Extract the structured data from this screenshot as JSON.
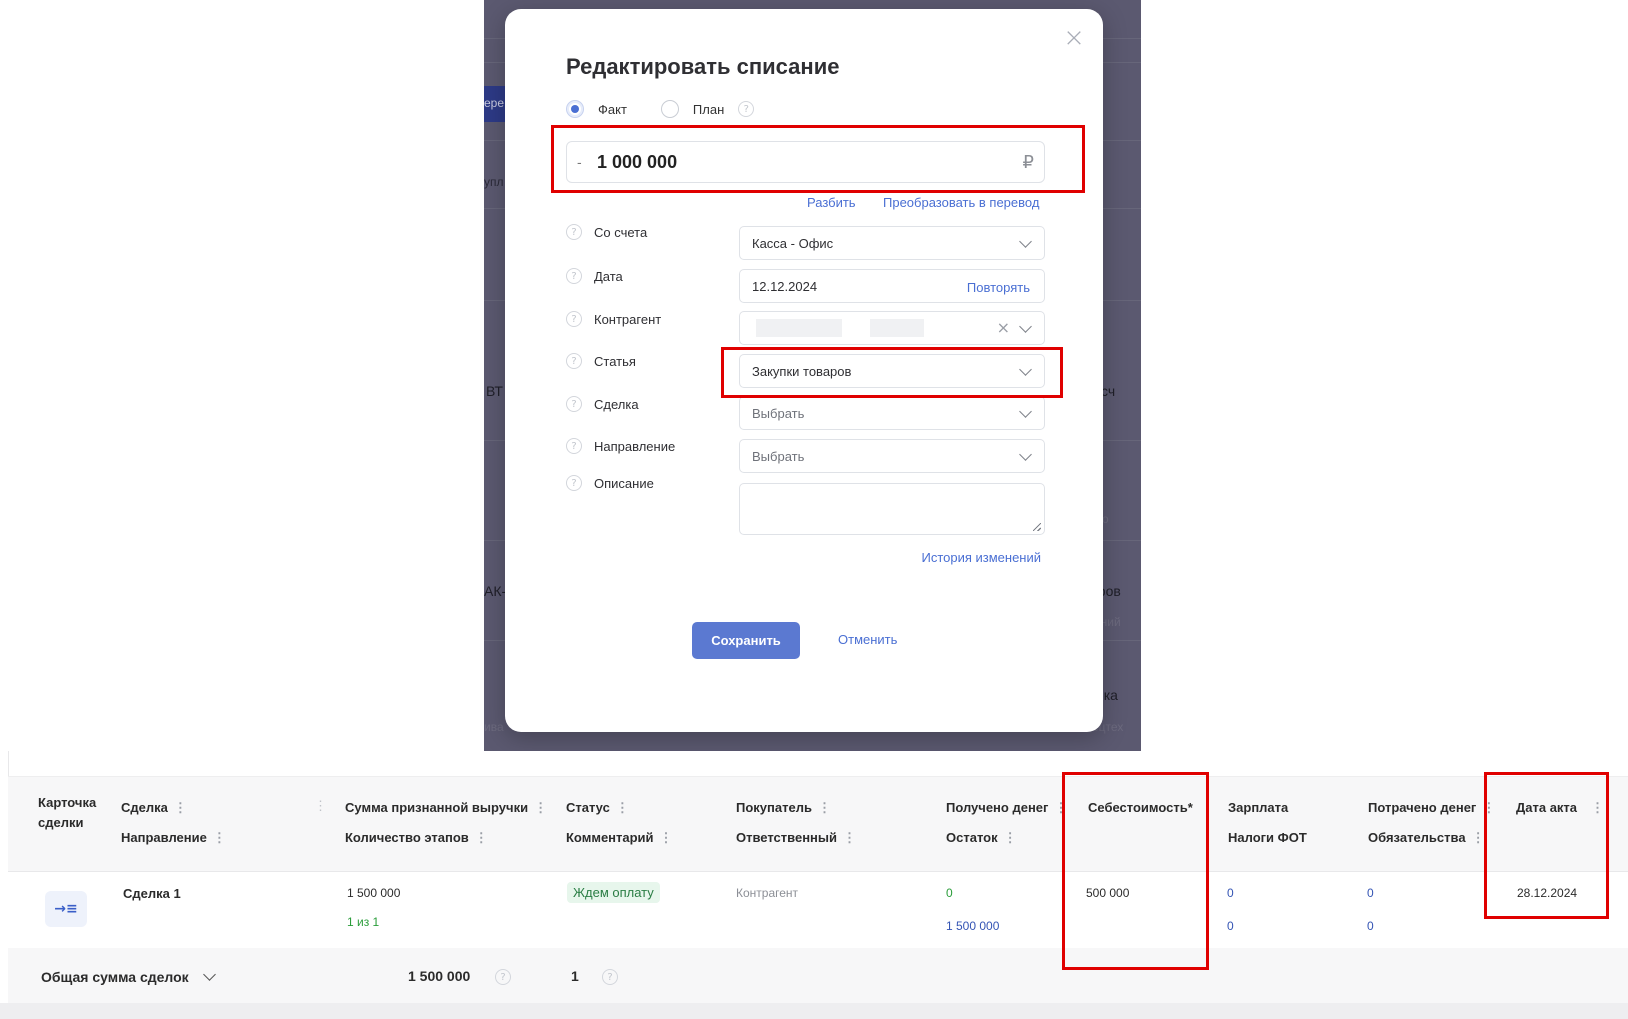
{
  "background": {
    "fragments": [
      "ере",
      "упл",
      "ВТ",
      "ду сч",
      "о",
      "АК-",
      "аров",
      "ений",
      "ива",
      "нка",
      "ецтех"
    ]
  },
  "modal": {
    "title": "Редактировать списание",
    "close_icon": "close-icon",
    "type_options": [
      {
        "label": "Факт",
        "checked": true
      },
      {
        "label": "План",
        "checked": false
      }
    ],
    "amount": {
      "sign": "-",
      "value": "1 000 000",
      "currency": "₽"
    },
    "split_link": "Разбить",
    "convert_link": "Преобразовать в перевод",
    "fields": {
      "account": {
        "label": "Со счета",
        "value": "Касса - Офис"
      },
      "date": {
        "label": "Дата",
        "value": "12.12.2024",
        "action": "Повторять"
      },
      "counterparty": {
        "label": "Контрагент",
        "value": ""
      },
      "category": {
        "label": "Статья",
        "value": "Закупки товаров"
      },
      "deal": {
        "label": "Сделка",
        "placeholder": "Выбрать"
      },
      "direction": {
        "label": "Направление",
        "placeholder": "Выбрать"
      },
      "description": {
        "label": "Описание",
        "value": ""
      }
    },
    "history_link": "История изменений",
    "save_label": "Сохранить",
    "cancel_label": "Отменить"
  },
  "table": {
    "headers": {
      "card": "Карточка сделки",
      "deal": "Сделка",
      "direction": "Направление",
      "revenue": "Сумма признанной выручки",
      "stages": "Количество этапов",
      "status": "Статус",
      "comment": "Комментарий",
      "buyer": "Покупатель",
      "responsible": "Ответственный",
      "received": "Получено денег",
      "remainder": "Остаток",
      "cost": "Себестоимость*",
      "salary": "Зарплата",
      "payroll_tax": "Налоги ФОТ",
      "spent": "Потрачено денег",
      "liabilities": "Обязательства",
      "act_date": "Дата акта"
    },
    "row": {
      "deal": "Сделка 1",
      "revenue": "1 500 000",
      "stages": "1 из 1",
      "status": "Ждем оплату",
      "buyer": "Контрагент",
      "received": "0",
      "remainder": "1 500 000",
      "cost": "500 000",
      "salary": "0",
      "payroll_tax": "0",
      "spent": "0",
      "liabilities": "0",
      "act_date": "28.12.2024"
    },
    "total": {
      "label": "Общая сумма сделок",
      "revenue": "1 500 000",
      "count": "1"
    }
  },
  "colors": {
    "accent": "#5b79d1",
    "highlight": "#e00000",
    "overlay": "#5b5970"
  }
}
